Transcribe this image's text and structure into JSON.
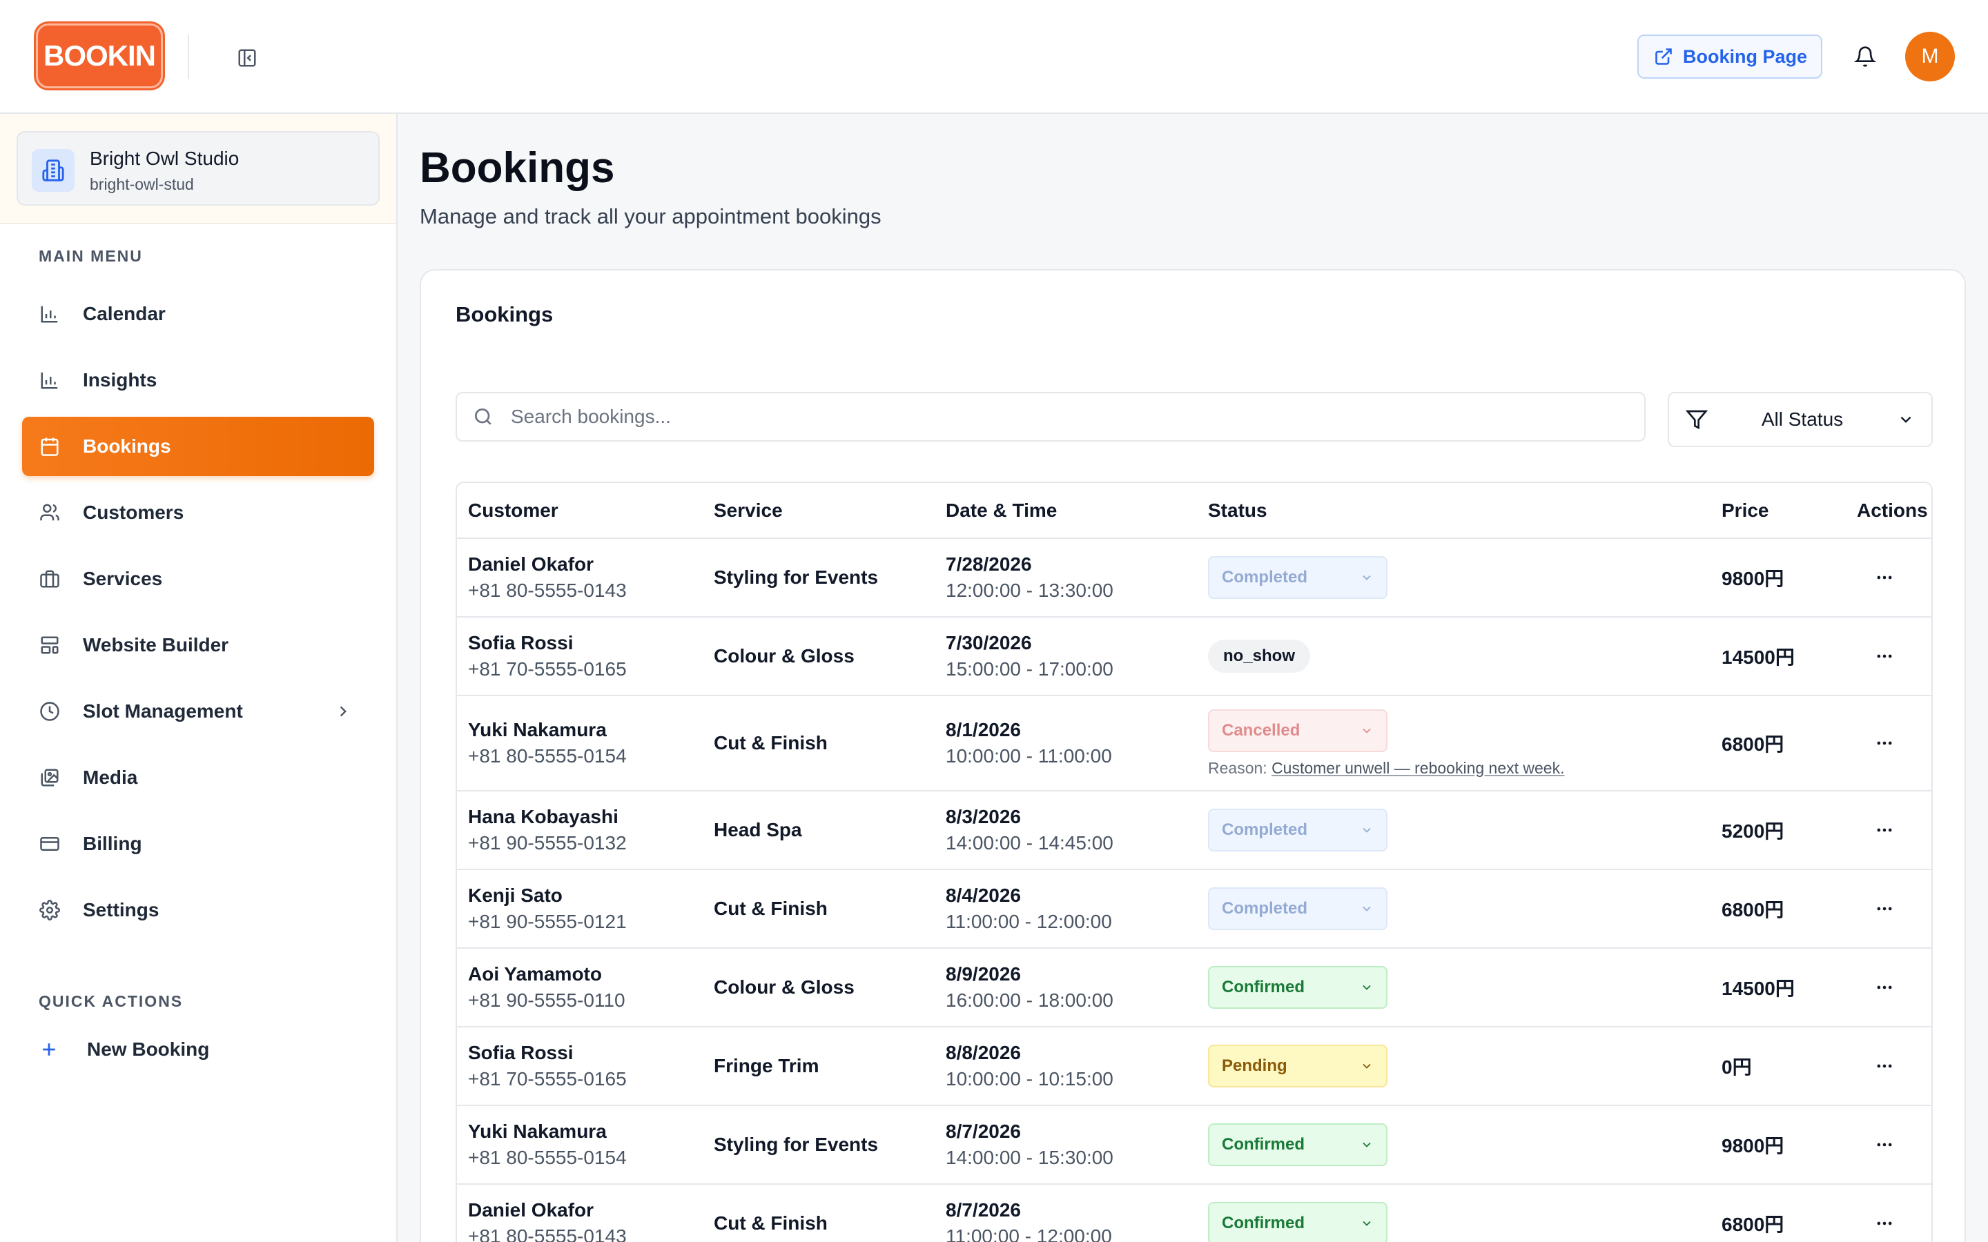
{
  "header": {
    "logo_text": "BOOKIN",
    "booking_page_label": "Booking Page",
    "avatar_initial": "M"
  },
  "studio": {
    "name": "Bright Owl Studio",
    "slug": "bright-owl-stud"
  },
  "sidebar": {
    "main_menu_label": "MAIN MENU",
    "items": [
      {
        "label": "Calendar",
        "icon": "bar-chart-icon"
      },
      {
        "label": "Insights",
        "icon": "bar-chart-icon"
      },
      {
        "label": "Bookings",
        "icon": "calendar-icon",
        "active": true
      },
      {
        "label": "Customers",
        "icon": "users-icon"
      },
      {
        "label": "Services",
        "icon": "briefcase-icon"
      },
      {
        "label": "Website Builder",
        "icon": "layout-icon"
      },
      {
        "label": "Slot Management",
        "icon": "clock-icon",
        "has_submenu": true
      },
      {
        "label": "Media",
        "icon": "images-icon"
      },
      {
        "label": "Billing",
        "icon": "credit-card-icon"
      },
      {
        "label": "Settings",
        "icon": "gear-icon"
      }
    ],
    "quick_actions_label": "QUICK ACTIONS",
    "new_booking_label": "New Booking"
  },
  "page": {
    "title": "Bookings",
    "subtitle": "Manage and track all your appointment bookings"
  },
  "bookings_card": {
    "title": "Bookings",
    "search_placeholder": "Search bookings...",
    "status_filter_value": "All Status",
    "columns": [
      "Customer",
      "Service",
      "Date & Time",
      "Status",
      "Price",
      "Actions"
    ],
    "rows": [
      {
        "customer": "Daniel Okafor",
        "phone": "+81 80-5555-0143",
        "service": "Styling for Events",
        "date": "7/28/2026",
        "time": "12:00:00 - 13:30:00",
        "status": "Completed",
        "status_type": "select",
        "price": "9800円"
      },
      {
        "customer": "Sofia Rossi",
        "phone": "+81 70-5555-0165",
        "service": "Colour & Gloss",
        "date": "7/30/2026",
        "time": "15:00:00 - 17:00:00",
        "status": "no_show",
        "status_type": "badge",
        "price": "14500円"
      },
      {
        "customer": "Yuki Nakamura",
        "phone": "+81 80-5555-0154",
        "service": "Cut & Finish",
        "date": "8/1/2026",
        "time": "10:00:00 - 11:00:00",
        "status": "Cancelled",
        "status_type": "select",
        "reason_label": "Reason:",
        "reason": "Customer unwell — rebooking next week.",
        "price": "6800円"
      },
      {
        "customer": "Hana Kobayashi",
        "phone": "+81 90-5555-0132",
        "service": "Head Spa",
        "date": "8/3/2026",
        "time": "14:00:00 - 14:45:00",
        "status": "Completed",
        "status_type": "select",
        "price": "5200円"
      },
      {
        "customer": "Kenji Sato",
        "phone": "+81 90-5555-0121",
        "service": "Cut & Finish",
        "date": "8/4/2026",
        "time": "11:00:00 - 12:00:00",
        "status": "Completed",
        "status_type": "select",
        "price": "6800円"
      },
      {
        "customer": "Aoi Yamamoto",
        "phone": "+81 90-5555-0110",
        "service": "Colour & Gloss",
        "date": "8/9/2026",
        "time": "16:00:00 - 18:00:00",
        "status": "Confirmed",
        "status_type": "select",
        "price": "14500円"
      },
      {
        "customer": "Sofia Rossi",
        "phone": "+81 70-5555-0165",
        "service": "Fringe Trim",
        "date": "8/8/2026",
        "time": "10:00:00 - 10:15:00",
        "status": "Pending",
        "status_type": "select",
        "price": "0円"
      },
      {
        "customer": "Yuki Nakamura",
        "phone": "+81 80-5555-0154",
        "service": "Styling for Events",
        "date": "8/7/2026",
        "time": "14:00:00 - 15:30:00",
        "status": "Confirmed",
        "status_type": "select",
        "price": "9800円"
      },
      {
        "customer": "Daniel Okafor",
        "phone": "+81 80-5555-0143",
        "service": "Cut & Finish",
        "date": "8/7/2026",
        "time": "11:00:00 - 12:00:00",
        "status": "Confirmed",
        "status_type": "select",
        "price": "6800円"
      }
    ]
  },
  "colors": {
    "brand_orange": "#f3612c",
    "active_nav": "#ec6a04",
    "link_blue": "#2563eb"
  }
}
